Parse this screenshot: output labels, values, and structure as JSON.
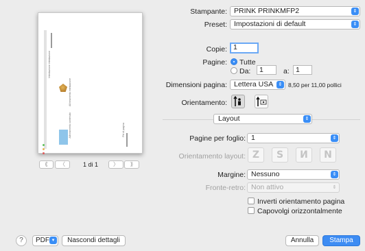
{
  "preview": {
    "header_text": "Intestazione intestazione",
    "body_text_1": "Allineamento intestazione",
    "body_text_2": "Allineamento contenuto",
    "footer_text": "Piè di pagina"
  },
  "pager": {
    "first": "⟪",
    "prev": "〈",
    "indicator": "1 di 1",
    "next": "〉",
    "last": "⟫"
  },
  "printer": {
    "label": "Stampante:",
    "value": "PRINK PRINKMFP2"
  },
  "preset": {
    "label": "Preset:",
    "value": "Impostazioni di default"
  },
  "copies": {
    "label": "Copie:",
    "value": "1"
  },
  "pages": {
    "label": "Pagine:",
    "all_label": "Tutte",
    "from_label": "Da:",
    "from_value": "1",
    "to_label": "a:",
    "to_value": "1"
  },
  "paper_size": {
    "label": "Dimensioni pagina:",
    "value": "Lettera USA",
    "info": "8,50 per 11,00 pollici"
  },
  "orientation": {
    "label": "Orientamento:"
  },
  "section": {
    "value": "Layout"
  },
  "pages_per_sheet": {
    "label": "Pagine per foglio:",
    "value": "1"
  },
  "layout_direction": {
    "label": "Orientamento layout:",
    "options": [
      "Z",
      "S",
      "И",
      "N"
    ]
  },
  "border": {
    "label": "Margine:",
    "value": "Nessuno"
  },
  "two_sided": {
    "label": "Fronte-retro:",
    "value": "Non attivo"
  },
  "reverse_orientation": {
    "label": "Inverti orientamento pagina"
  },
  "flip_horizontal": {
    "label": "Capovolgi orizzontalmente"
  },
  "footer": {
    "help": "?",
    "pdf": "PDF",
    "hide_details": "Nascondi dettagli",
    "cancel": "Annulla",
    "print": "Stampa"
  },
  "colors": {
    "accent": "#3a8ef6",
    "window_bg": "#ececec"
  }
}
